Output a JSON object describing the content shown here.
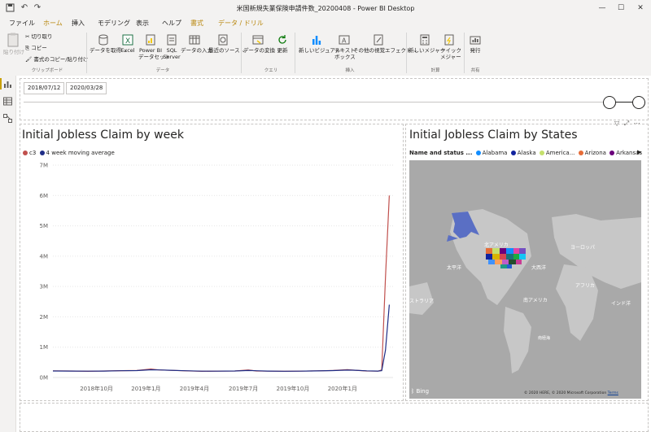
{
  "window": {
    "title": "米国新規失業保険申請件数_20200408 - Power BI Desktop",
    "controls": [
      "minimize",
      "maximize",
      "close"
    ]
  },
  "tabs": [
    {
      "label": "ファイル"
    },
    {
      "label": "ホーム"
    },
    {
      "label": "挿入"
    },
    {
      "label": "モデリング"
    },
    {
      "label": "表示"
    },
    {
      "label": "ヘルプ"
    },
    {
      "label": "書式"
    },
    {
      "label": "データ / ドリル"
    }
  ],
  "ribbon": {
    "clipboard": {
      "paste": "貼り付け",
      "cut": "切り取り",
      "copy": "コピー",
      "format_painter": "書式のコピー/貼り付け",
      "group": "クリップボード"
    },
    "data": {
      "get_data": "データを取得",
      "excel": "Excel",
      "pbi_datasets_1": "Power BI",
      "pbi_datasets_2": "データセット",
      "sql_1": "SQL",
      "sql_2": "Server",
      "enter_data": "データの入力",
      "recent_sources": "最近のソース",
      "group": "データ"
    },
    "query": {
      "transform": "データの変換",
      "refresh": "更新",
      "group": "クエリ"
    },
    "insert": {
      "new_visual": "新しいビジュアル",
      "textbox_1": "テキスト",
      "textbox_2": "ボックス",
      "more_visuals": "その他の視覚エフェクト",
      "group": "挿入"
    },
    "calculations": {
      "new_measure": "新しいメジャー",
      "quick_measure_1": "クイック",
      "quick_measure_2": "メジャー",
      "group": "計算"
    },
    "share": {
      "publish": "発行",
      "group": "共有"
    }
  },
  "slicer": {
    "start": "2018/07/12",
    "end": "2020/03/28",
    "start_fraction": 0.0,
    "end_fraction": 1.0
  },
  "line_visual": {
    "title": "Initial Jobless Claim by week",
    "legend": [
      {
        "label": "c3",
        "color": "#c0504d"
      },
      {
        "label": "4 week moving average",
        "color": "#1f2d86"
      }
    ]
  },
  "map_visual": {
    "title": "Initial Jobless Claim by States",
    "legend_title": "Name and status ...",
    "legend": [
      {
        "label": "Alabama",
        "color": "#118dff"
      },
      {
        "label": "Alaska",
        "color": "#12239e"
      },
      {
        "label": "America...",
        "color": "#c5e06c"
      },
      {
        "label": "Arizona",
        "color": "#e66c37"
      },
      {
        "label": "Arkansas",
        "color": "#6b007b"
      }
    ],
    "labels": {
      "north_america": "北アメリカ",
      "europe": "ヨーロッパ",
      "pacific": "太平洋",
      "atlantic": "大西洋",
      "africa": "アフリカ",
      "south_america": "南アメリカ",
      "indian_ocean": "インド洋",
      "australia_part": "ストラリア",
      "south_ocean": "南極海"
    },
    "bing": "Bing",
    "copyright": "© 2020 HERE, © 2020 Microsoft Corporation",
    "terms": "Terms"
  },
  "chart_data": {
    "type": "line",
    "title": "Initial Jobless Claim by week",
    "y_ticks": [
      "0M",
      "1M",
      "2M",
      "3M",
      "4M",
      "5M",
      "6M",
      "7M"
    ],
    "x_ticks": [
      "2018年10月",
      "2019年1月",
      "2019年4月",
      "2019年7月",
      "2019年10月",
      "2020年1月"
    ],
    "ylim": [
      0,
      7000000
    ],
    "xlim": [
      "2018-07-12",
      "2020-04-04"
    ],
    "series": [
      {
        "name": "c3",
        "color": "#c0504d",
        "points": [
          [
            "2018-07-12",
            220000
          ],
          [
            "2018-08-15",
            215000
          ],
          [
            "2018-09-15",
            205000
          ],
          [
            "2018-10-15",
            215000
          ],
          [
            "2018-11-15",
            225000
          ],
          [
            "2018-12-15",
            230000
          ],
          [
            "2019-01-10",
            280000
          ],
          [
            "2019-01-25",
            250000
          ],
          [
            "2019-02-15",
            235000
          ],
          [
            "2019-03-15",
            220000
          ],
          [
            "2019-04-15",
            205000
          ],
          [
            "2019-05-15",
            210000
          ],
          [
            "2019-06-15",
            215000
          ],
          [
            "2019-07-10",
            250000
          ],
          [
            "2019-07-25",
            215000
          ],
          [
            "2019-08-15",
            210000
          ],
          [
            "2019-09-15",
            205000
          ],
          [
            "2019-10-15",
            210000
          ],
          [
            "2019-11-15",
            220000
          ],
          [
            "2019-12-15",
            230000
          ],
          [
            "2020-01-10",
            260000
          ],
          [
            "2020-01-25",
            240000
          ],
          [
            "2020-02-15",
            215000
          ],
          [
            "2020-03-07",
            210000
          ],
          [
            "2020-03-14",
            250000
          ],
          [
            "2020-03-21",
            3300000
          ],
          [
            "2020-03-28",
            6000000
          ]
        ]
      },
      {
        "name": "4 week moving average",
        "color": "#1f2d86",
        "points": [
          [
            "2018-07-12",
            215000
          ],
          [
            "2018-08-15",
            212000
          ],
          [
            "2018-09-15",
            208000
          ],
          [
            "2018-10-15",
            212000
          ],
          [
            "2018-11-15",
            222000
          ],
          [
            "2018-12-15",
            228000
          ],
          [
            "2019-01-10",
            255000
          ],
          [
            "2019-01-25",
            250000
          ],
          [
            "2019-02-15",
            238000
          ],
          [
            "2019-03-15",
            222000
          ],
          [
            "2019-04-15",
            208000
          ],
          [
            "2019-05-15",
            210000
          ],
          [
            "2019-06-15",
            214000
          ],
          [
            "2019-07-10",
            230000
          ],
          [
            "2019-07-25",
            222000
          ],
          [
            "2019-08-15",
            212000
          ],
          [
            "2019-09-15",
            207000
          ],
          [
            "2019-10-15",
            210000
          ],
          [
            "2019-11-15",
            218000
          ],
          [
            "2019-12-15",
            228000
          ],
          [
            "2020-01-10",
            245000
          ],
          [
            "2020-01-25",
            240000
          ],
          [
            "2020-02-15",
            220000
          ],
          [
            "2020-03-07",
            212000
          ],
          [
            "2020-03-14",
            225000
          ],
          [
            "2020-03-21",
            900000
          ],
          [
            "2020-03-28",
            2400000
          ]
        ]
      }
    ]
  }
}
